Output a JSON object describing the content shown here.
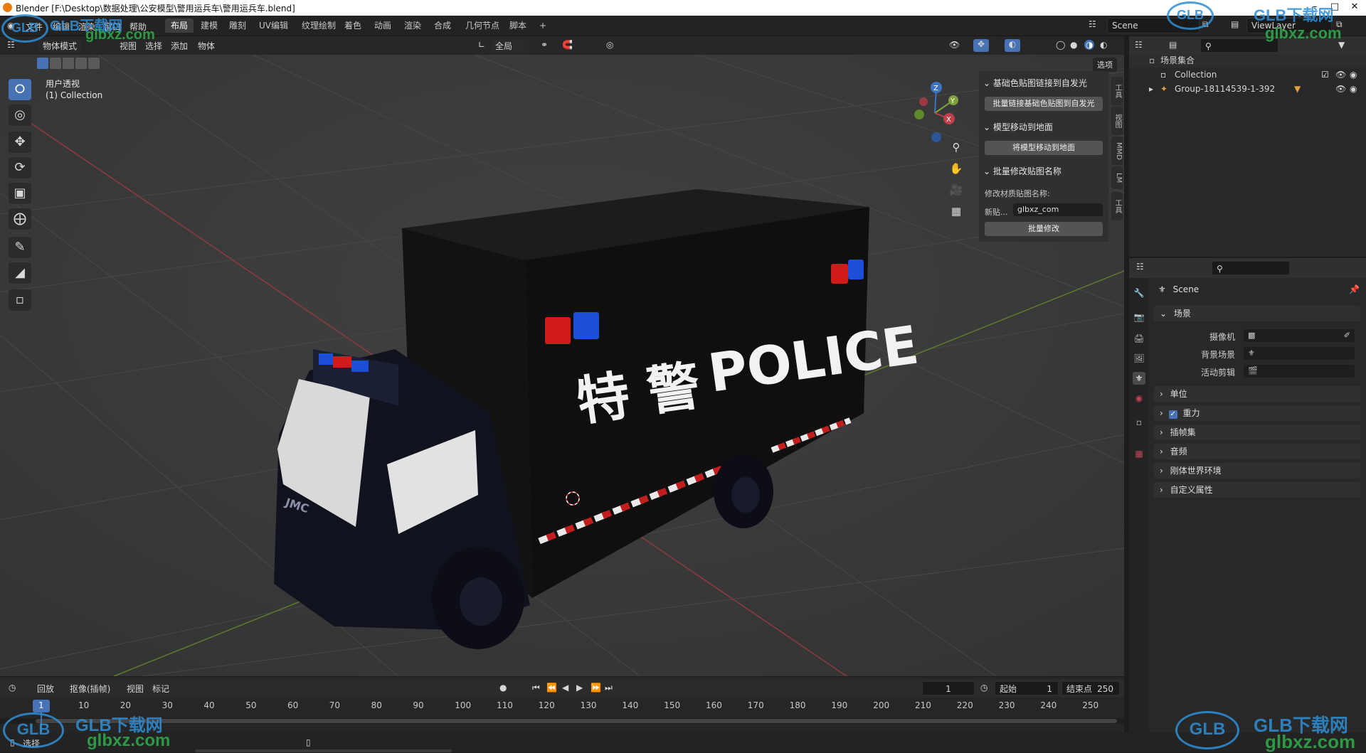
{
  "window": {
    "title": "Blender [F:\\Desktop\\数据处理\\公安模型\\警用运兵车\\警用运兵车.blend]"
  },
  "menu": {
    "items": [
      "文件",
      "编辑",
      "渲染",
      "窗口",
      "帮助"
    ],
    "workspaces": [
      "布局",
      "建模",
      "雕刻",
      "UV编辑",
      "纹理绘制",
      "着色",
      "动画",
      "渲染",
      "合成",
      "几何节点",
      "脚本"
    ],
    "active_workspace": "布局",
    "add_tab": "+",
    "scene_name": "Scene",
    "view_layer": "ViewLayer"
  },
  "viewport_header": {
    "mode": "物体模式",
    "menus": [
      "视图",
      "选择",
      "添加",
      "物体"
    ],
    "transform_orientation": "全局",
    "options": "选项"
  },
  "viewport": {
    "view_name": "用户透视",
    "collection_label": "(1) Collection",
    "vehicle_text": {
      "chinese": "特 警",
      "english": "POLICE",
      "grille_brand": "JMC"
    }
  },
  "gizmo": {
    "x": "X",
    "y": "Y",
    "z": "Z"
  },
  "npanel": {
    "sections": [
      {
        "title": "基础色贴图链接到自发光",
        "button": "批量链接基础色贴图到自发光"
      },
      {
        "title": "模型移动到地面",
        "button": "将模型移动到地面"
      },
      {
        "title": "批量修改贴图名称",
        "field_caption": "修改材质贴图名称:",
        "field_label": "新贴...",
        "field_value": "glbxz_com",
        "button": "批量修改"
      }
    ],
    "tabs": [
      "工具",
      "视图",
      "MMD",
      "LM",
      "工具"
    ]
  },
  "outliner": {
    "scene_collection": "场景集合",
    "rows": [
      {
        "label": "Collection"
      },
      {
        "label": "Group-18114539-1-392"
      }
    ]
  },
  "properties": {
    "header": "Scene",
    "scene_section": "场景",
    "fields": [
      {
        "label": "摄像机",
        "value": ""
      },
      {
        "label": "背景场景",
        "value": ""
      },
      {
        "label": "活动剪辑",
        "value": ""
      }
    ],
    "sections": [
      "单位",
      "重力",
      "插帧集",
      "音频",
      "刚体世界环境",
      "自定义属性"
    ],
    "gravity_checked": true
  },
  "timeline": {
    "menus": [
      "回放",
      "抠像(插帧)",
      "视图",
      "标记"
    ],
    "current_frame": "1",
    "start_label": "起始",
    "start_value": "1",
    "end_label": "结束点",
    "end_value": "250",
    "ruler": [
      "1",
      "10",
      "20",
      "30",
      "40",
      "50",
      "60",
      "70",
      "80",
      "90",
      "100",
      "110",
      "120",
      "130",
      "140",
      "150",
      "160",
      "170",
      "180",
      "190",
      "200",
      "210",
      "220",
      "230",
      "240",
      "250"
    ]
  },
  "statusbar": {
    "left": "选择"
  },
  "watermarks": {
    "brand": "GLB下载网",
    "url": "glbxz.com",
    "logo": "GLB"
  },
  "colors": {
    "accent": "#4772b3",
    "x_axis": "#c13f4d",
    "y_axis": "#7ea13a",
    "z_axis": "#3d72c4",
    "watermark": "#2f8fd6"
  }
}
